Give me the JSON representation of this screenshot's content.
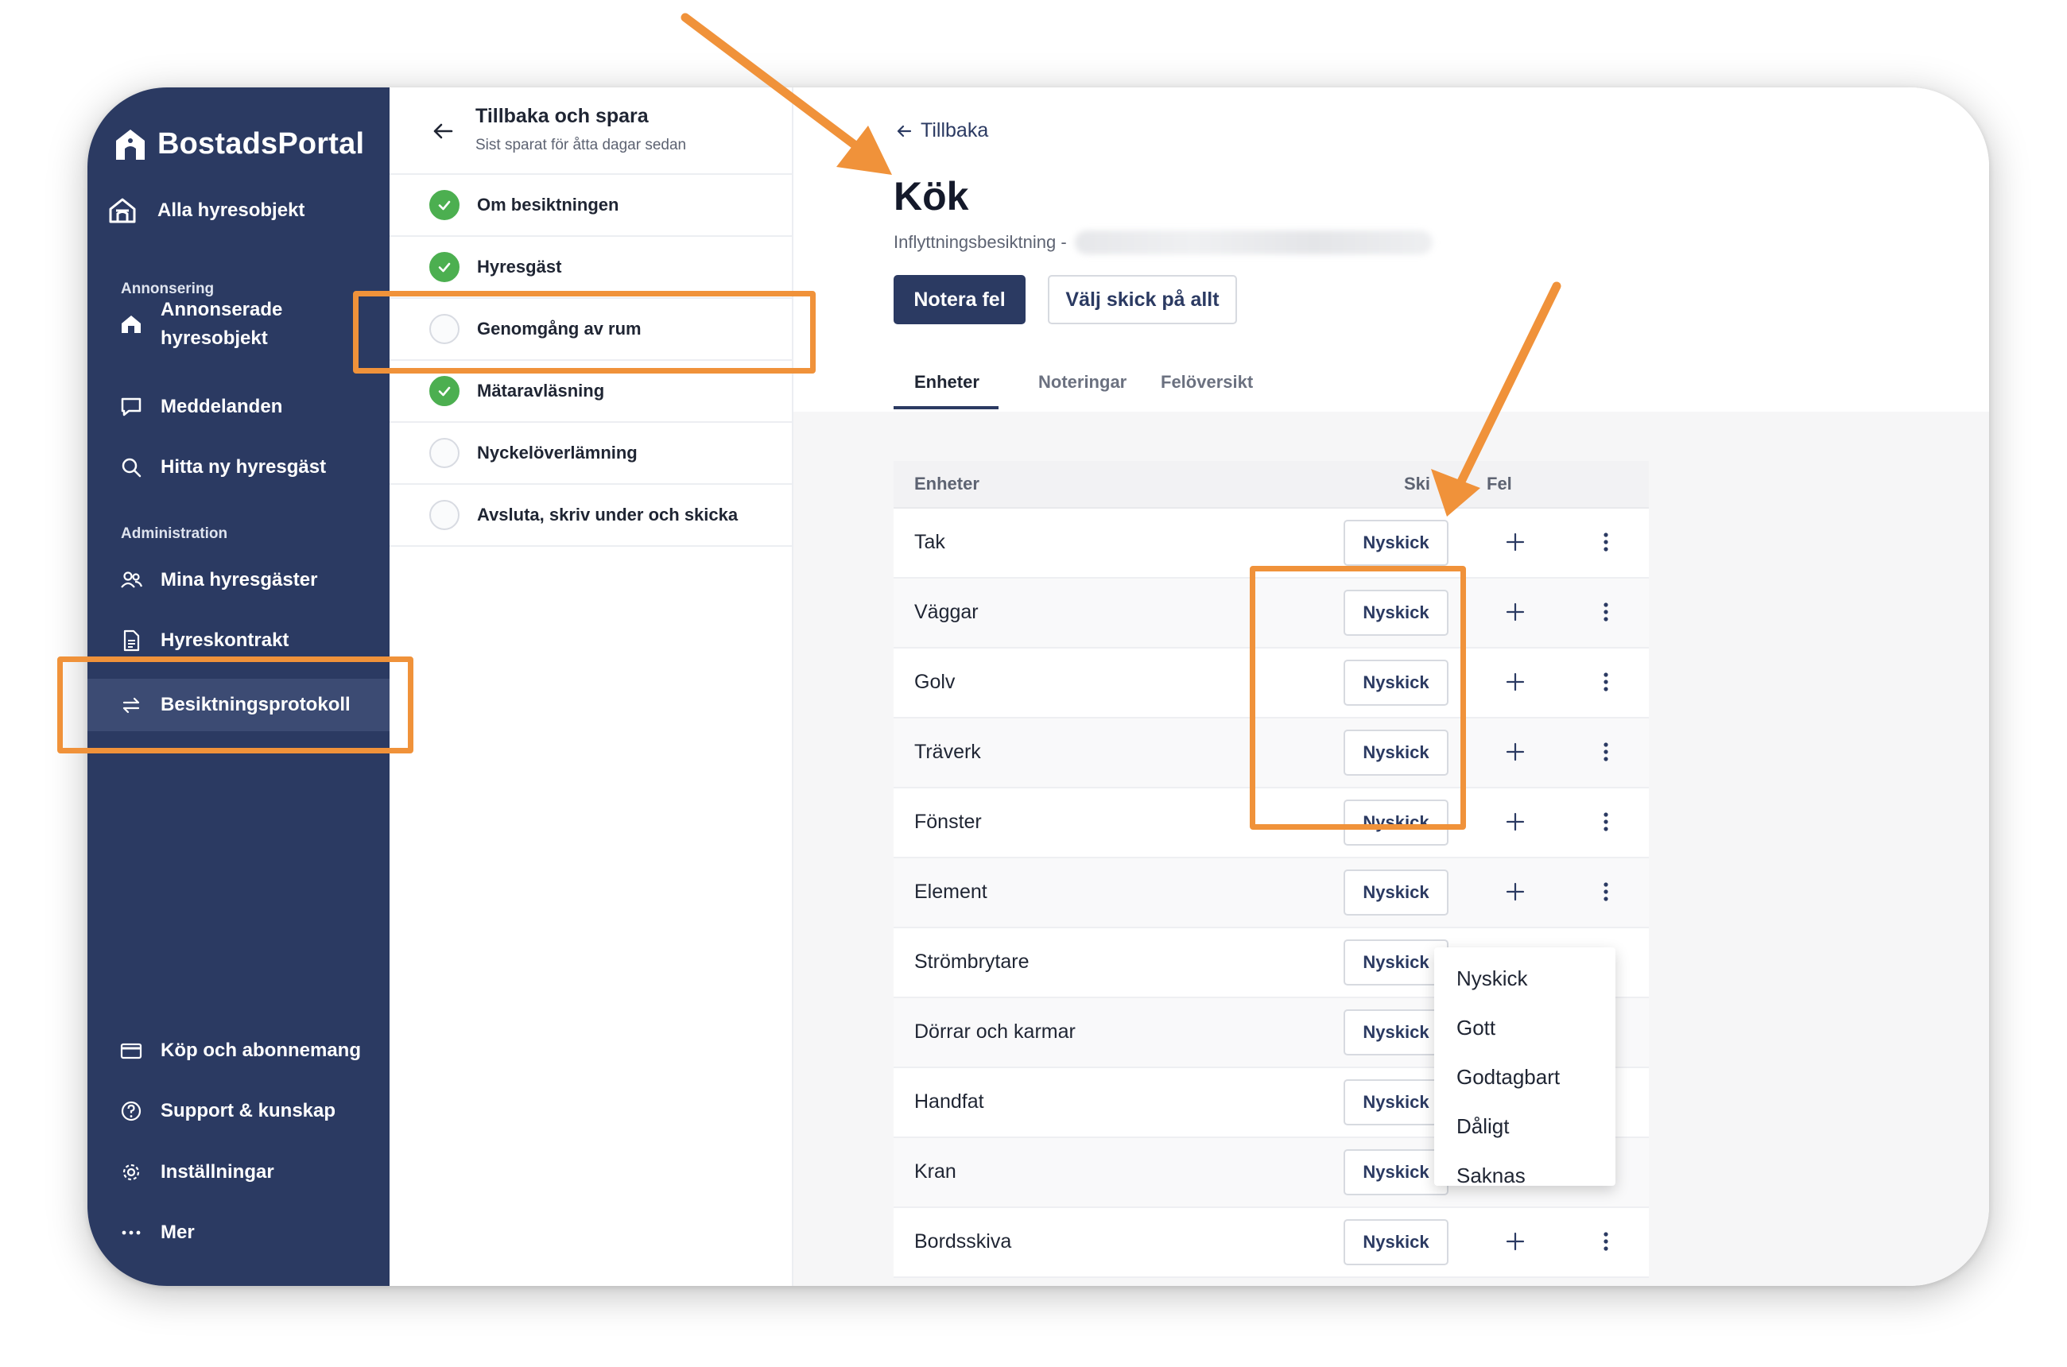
{
  "app": {
    "name": "BostadsPortal"
  },
  "sidebar": {
    "top_item": {
      "label": "Alla hyresobjekt",
      "icon": "home-icon"
    },
    "sections": [
      {
        "title": "Annonsering",
        "items": [
          {
            "label": "Annonserade hyresobjekt",
            "line1": "Annonserade",
            "line2": "hyresobjekt",
            "icon": "house-icon"
          },
          {
            "label": "Meddelanden",
            "icon": "chat-icon"
          },
          {
            "label": "Hitta ny hyresgäst",
            "icon": "search-icon"
          }
        ]
      },
      {
        "title": "Administration",
        "items": [
          {
            "label": "Mina hyresgäster",
            "icon": "users-icon"
          },
          {
            "label": "Hyreskontrakt",
            "icon": "document-icon"
          },
          {
            "label": "Besiktningsprotokoll",
            "icon": "swap-icon",
            "active": true
          }
        ]
      }
    ],
    "bottom_items": [
      {
        "label": "Köp och abonnemang",
        "icon": "credit-card-icon"
      },
      {
        "label": "Support & kunskap",
        "icon": "help-icon"
      },
      {
        "label": "Inställningar",
        "icon": "gear-icon"
      },
      {
        "label": "Mer",
        "icon": "more-horizontal-icon"
      }
    ]
  },
  "steps_panel": {
    "title": "Tillbaka och spara",
    "subtitle": "Sist sparat för åtta dagar sedan",
    "steps": [
      {
        "label": "Om besiktningen",
        "done": true
      },
      {
        "label": "Hyresgäst",
        "done": true
      },
      {
        "label": "Genomgång av rum",
        "done": false
      },
      {
        "label": "Mätaravläsning",
        "done": true
      },
      {
        "label": "Nyckelöverlämning",
        "done": false
      },
      {
        "label": "Avsluta, skriv under och skicka",
        "done": false
      }
    ]
  },
  "main": {
    "back_label": "Tillbaka",
    "title": "Kök",
    "subtitle": "Inflyttningsbesiktning -",
    "primary_button": "Notera fel",
    "secondary_button": "Välj skick på allt",
    "tabs": [
      "Enheter",
      "Noteringar",
      "Felöversikt"
    ],
    "active_tab": "Enheter",
    "table": {
      "headers": {
        "unit": "Enheter",
        "condition": "Ski",
        "fault": "Fel"
      },
      "rows": [
        {
          "name": "Tak",
          "condition": "Nyskick"
        },
        {
          "name": "Väggar",
          "condition": "Nyskick"
        },
        {
          "name": "Golv",
          "condition": "Nyskick"
        },
        {
          "name": "Träverk",
          "condition": "Nyskick"
        },
        {
          "name": "Fönster",
          "condition": "Nyskick"
        },
        {
          "name": "Element",
          "condition": "Nyskick"
        },
        {
          "name": "Strömbrytare",
          "condition": "Nyskick"
        },
        {
          "name": "Dörrar och karmar",
          "condition": "Nyskick"
        },
        {
          "name": "Handfat",
          "condition": "Nyskick"
        },
        {
          "name": "Kran",
          "condition": "Nyskick"
        },
        {
          "name": "Bordsskiva",
          "condition": "Nyskick"
        }
      ]
    },
    "condition_dropdown": {
      "open": true,
      "options": [
        "Nyskick",
        "Gott",
        "Godtagbart",
        "Dåligt",
        "Saknas"
      ]
    }
  },
  "colors": {
    "sidebar_bg": "#2b3a62",
    "primary": "#2b3a62",
    "success": "#4caf50",
    "highlight": "#f0923a"
  }
}
